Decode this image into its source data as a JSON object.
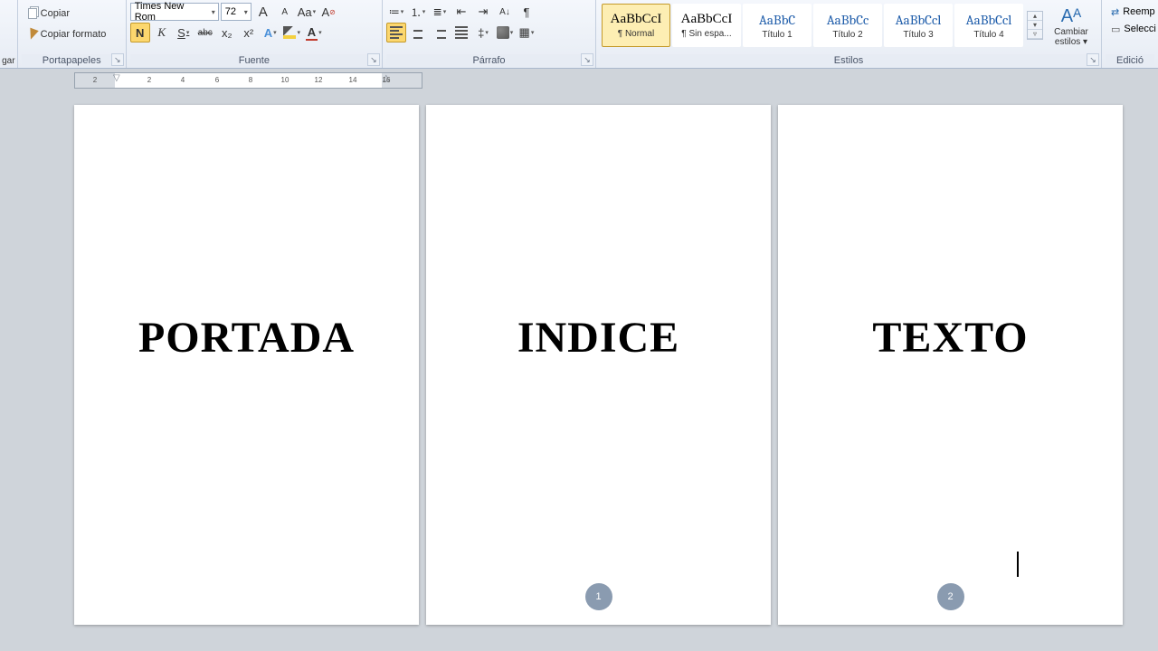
{
  "clipboard": {
    "paste": "gar",
    "copy": "Copiar",
    "format": "Copiar formato",
    "group": "Portapapeles"
  },
  "font": {
    "family": "Times New Rom",
    "size": "72",
    "bold": "N",
    "italic": "K",
    "underline": "S",
    "strike": "abc",
    "sub": "x₂",
    "sup": "x²",
    "grow": "A",
    "shrink": "A",
    "caseBtn": "Aa",
    "clear": "⌫",
    "color": "A",
    "highlight": "",
    "group": "Fuente"
  },
  "para": {
    "bullets": "•≡",
    "numbers": "1≡",
    "multi": "≡",
    "decInd": "⇤",
    "incInd": "⇥",
    "sort": "A↓Z",
    "marks": "¶",
    "alignL": "L",
    "alignC": "C",
    "alignR": "R",
    "justify": "J",
    "lineSp": "↕",
    "shade": "▦",
    "border": "▢",
    "group": "Párrafo"
  },
  "styles": {
    "group": "Estilos",
    "items": [
      {
        "sample": "AaBbCcI",
        "name": "¶ Normal",
        "blue": false,
        "sel": true
      },
      {
        "sample": "AaBbCcI",
        "name": "¶ Sin espa...",
        "blue": false,
        "sel": false
      },
      {
        "sample": "AaBbC",
        "name": "Título 1",
        "blue": true,
        "sel": false
      },
      {
        "sample": "AaBbCc",
        "name": "Título 2",
        "blue": true,
        "sel": false
      },
      {
        "sample": "AaBbCcl",
        "name": "Título 3",
        "blue": true,
        "sel": false
      },
      {
        "sample": "AaBbCcl",
        "name": "Título 4",
        "blue": true,
        "sel": false
      }
    ],
    "change": "Cambiar estilos ▾"
  },
  "editing": {
    "group": "Edició",
    "replace": "Reemp",
    "select": "Selecci"
  },
  "ruler": {
    "ticks": [
      "2",
      "2",
      "4",
      "6",
      "8",
      "10",
      "12",
      "14",
      "16"
    ]
  },
  "pages": [
    {
      "title": "PORTADA",
      "num": null
    },
    {
      "title": "INDICE",
      "num": "1"
    },
    {
      "title": "TEXTO",
      "num": "2"
    }
  ]
}
